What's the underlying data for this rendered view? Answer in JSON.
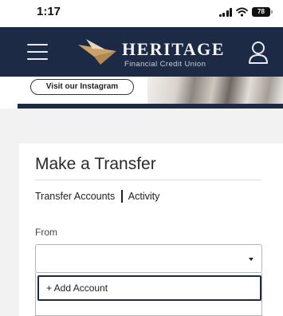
{
  "status_bar": {
    "time": "1:17",
    "battery": "78"
  },
  "header": {
    "brand_name": "HERITAGE",
    "brand_subtitle": "Financial Credit Union",
    "bg_color": "#1d2a45",
    "brand_mark_colors": [
      "#c9a36b",
      "#e8d7b5"
    ]
  },
  "banner": {
    "instagram_button": "Visit our Instagram"
  },
  "transfer": {
    "title": "Make a Transfer",
    "tabs": [
      {
        "label": "Transfer Accounts"
      },
      {
        "label": "Activity"
      }
    ],
    "from_label": "From",
    "from_value": "",
    "options": [
      {
        "label": "+ Add Account",
        "highlighted": true
      }
    ]
  }
}
